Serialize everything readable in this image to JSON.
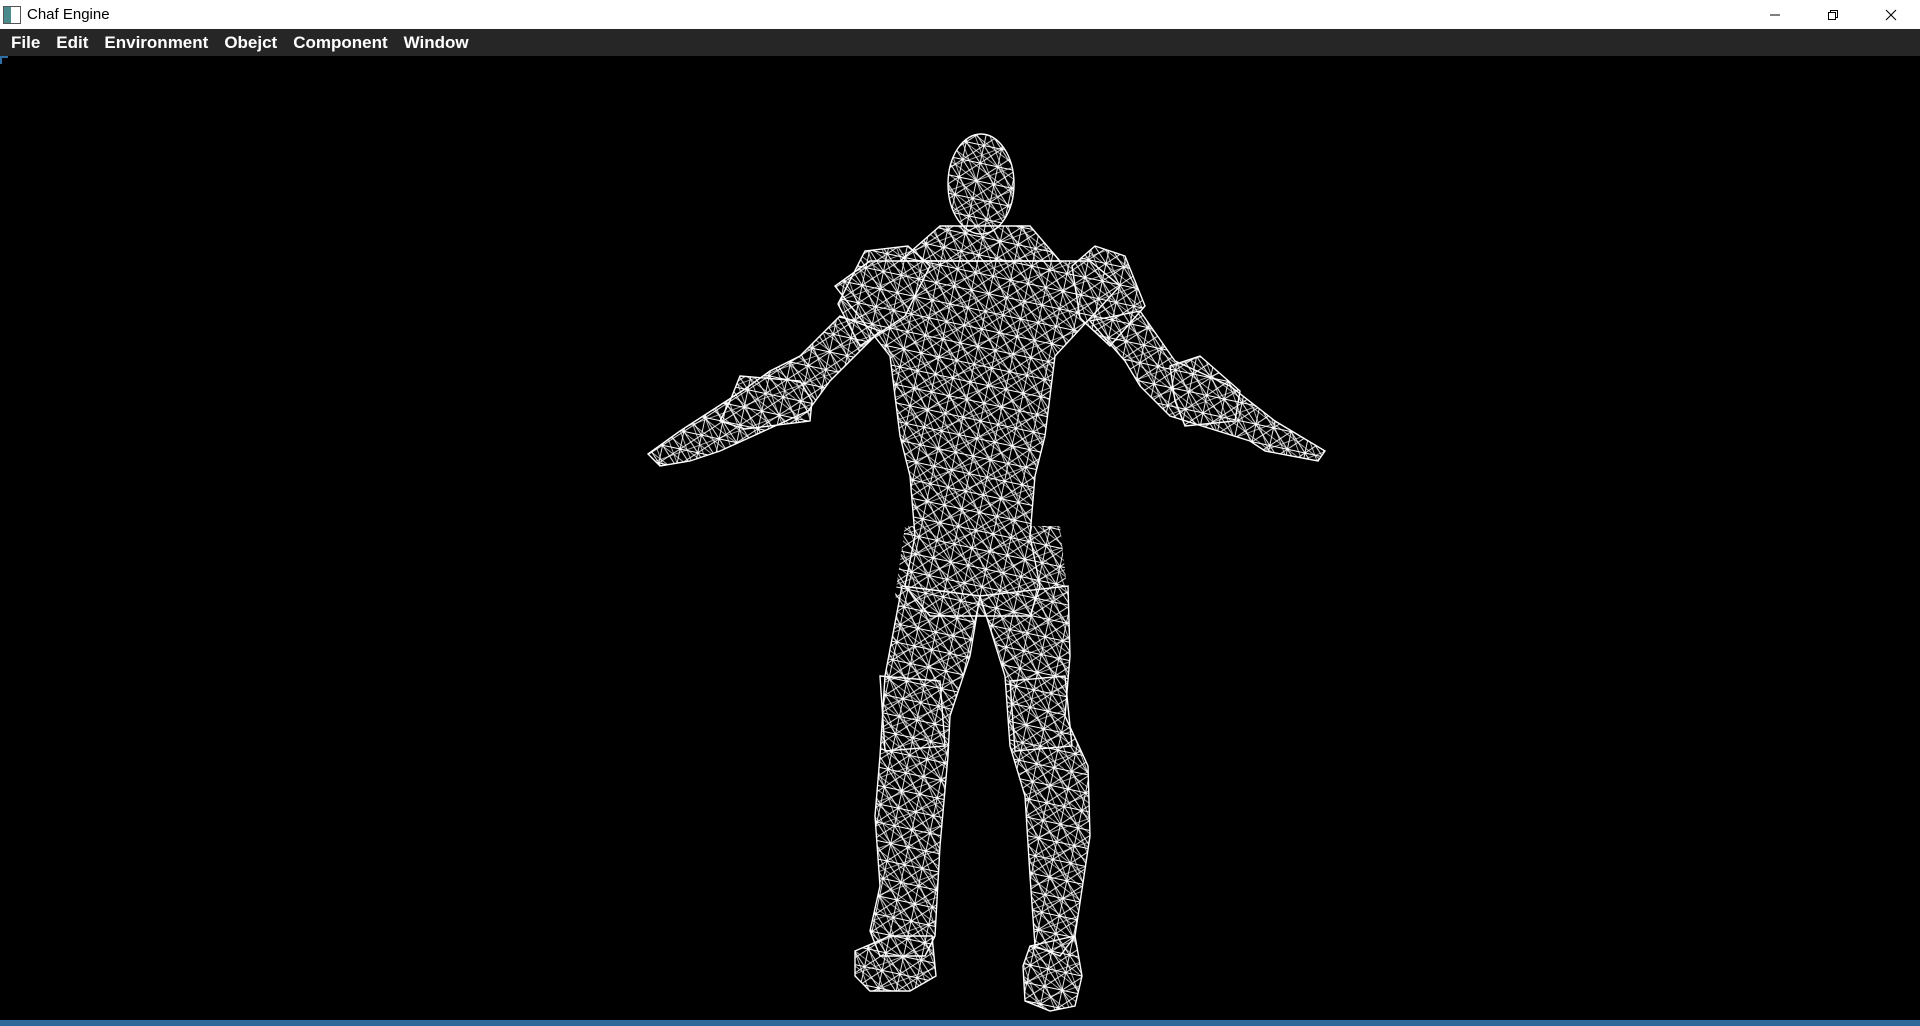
{
  "window": {
    "title": "Chaf Engine",
    "controls": {
      "minimize": "minimize-icon",
      "restore": "restore-icon",
      "close": "close-icon"
    }
  },
  "menubar": {
    "items": [
      {
        "label": "File"
      },
      {
        "label": "Edit"
      },
      {
        "label": "Environment"
      },
      {
        "label": "Obejct"
      },
      {
        "label": "Component"
      },
      {
        "label": "Window"
      }
    ]
  },
  "viewport": {
    "background": "#000000",
    "wireframe_color": "#ffffff",
    "model": "humanoid-wireframe-tpose"
  },
  "colors": {
    "titlebar": "#ffffff",
    "menubar": "#262626",
    "accent": "#2d6a9a"
  }
}
